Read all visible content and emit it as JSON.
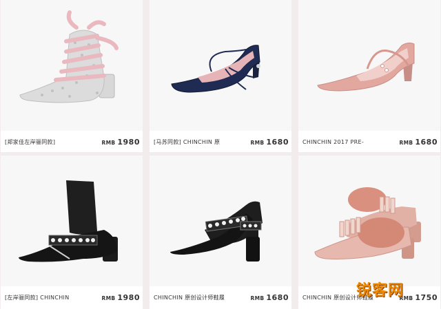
{
  "products": [
    {
      "name": "[郑家佳左岸骊同款]",
      "currency": "RMB",
      "price": "1980",
      "icon": "glitter-lace-up-boot"
    },
    {
      "name": "[马苏同款] CHINCHIN 原",
      "currency": "RMB",
      "price": "1680",
      "icon": "navy-velvet-pump"
    },
    {
      "name": "CHINCHIN 2017 PRE-",
      "currency": "RMB",
      "price": "1680",
      "icon": "pink-mary-jane-pump"
    },
    {
      "name": "[左岸骊同款] CHINCHIN",
      "currency": "RMB",
      "price": "1980",
      "icon": "black-sock-boot"
    },
    {
      "name": "CHINCHIN 原创设计师鞋履",
      "currency": "RMB",
      "price": "1680",
      "icon": "black-pearl-strap-pump"
    },
    {
      "name": "CHINCHIN 原创设计师鞋履",
      "currency": "RMB",
      "price": "1750",
      "icon": "fur-fringe-mule"
    }
  ],
  "watermark": {
    "text": "锐客网",
    "color": "#f08a00"
  }
}
